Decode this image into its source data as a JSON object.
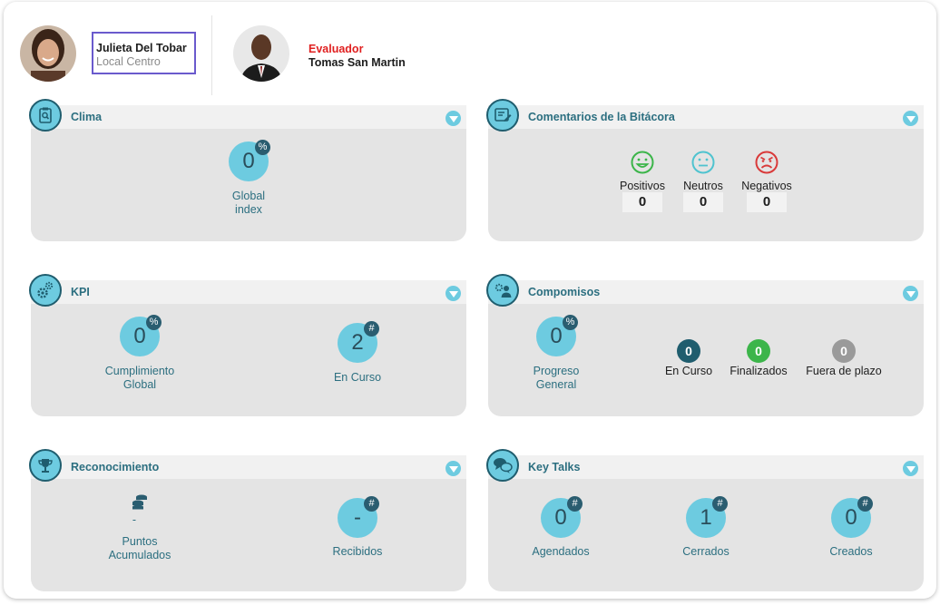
{
  "header": {
    "user_name": "Julieta Del Tobar",
    "user_location": "Local Centro",
    "evaluator_role": "Evaluador",
    "evaluator_name": "Tomas San Martin"
  },
  "cards": {
    "clima": {
      "title": "Clima",
      "value": "0",
      "badge": "%",
      "label_line1": "Global",
      "label_line2": "index"
    },
    "bitacora": {
      "title": "Comentarios de la Bitácora",
      "positive_label": "Positivos",
      "positive_count": "0",
      "neutral_label": "Neutros",
      "neutral_count": "0",
      "negative_label": "Negativos",
      "negative_count": "0"
    },
    "kpi": {
      "title": "KPI",
      "cumplimiento_value": "0",
      "cumplimiento_badge": "%",
      "cumplimiento_line1": "Cumplimiento",
      "cumplimiento_line2": "Global",
      "en_curso_value": "2",
      "en_curso_badge": "#",
      "en_curso_label": "En Curso"
    },
    "compromisos": {
      "title": "Compomisos",
      "progreso_value": "0",
      "progreso_badge": "%",
      "progreso_line1": "Progreso",
      "progreso_line2": "General",
      "en_curso_value": "0",
      "en_curso_label": "En Curso",
      "finalizados_value": "0",
      "finalizados_label": "Finalizados",
      "fuera_value": "0",
      "fuera_label": "Fuera de plazo"
    },
    "reconocimiento": {
      "title": "Reconocimiento",
      "puntos_value": "-",
      "puntos_line1": "Puntos",
      "puntos_line2": "Acumulados",
      "recibidos_value": "-",
      "recibidos_badge": "#",
      "recibidos_label": "Recibidos"
    },
    "keytalks": {
      "title": "Key Talks",
      "agendados_value": "0",
      "agendados_badge": "#",
      "agendados_label": "Agendados",
      "cerrados_value": "1",
      "cerrados_badge": "#",
      "cerrados_label": "Cerrados",
      "creados_value": "0",
      "creados_badge": "#",
      "creados_label": "Creados"
    }
  },
  "colors": {
    "accent": "#6dcbe0",
    "title_text": "#2c6f80",
    "dark_teal": "#1f5d6e",
    "positive": "#3cb54a",
    "neutral": "#4fc3cf",
    "negative": "#d93a3a",
    "finalizados": "#3cb54a",
    "fuera": "#9a9a9a",
    "evaluator_role": "#e02020"
  }
}
